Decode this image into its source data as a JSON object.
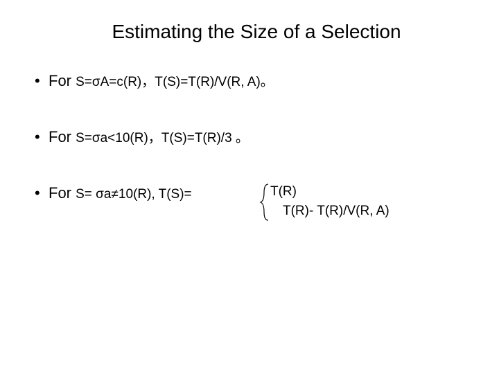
{
  "title": "Estimating the Size of  a Selection",
  "bullets": [
    {
      "for": "For ",
      "formula": "S=σA=c(R)，T(S)=T(R)/V(R, A)。"
    },
    {
      "for": "For ",
      "formula": "S=σa<10(R)，T(S)=T(R)/3 。"
    },
    {
      "for": "For ",
      "formula_prefix": "S= σa≠10(R), T(S)=",
      "branch1": "T(R)",
      "branch2": "T(R)- T(R)/V(R, A)"
    }
  ]
}
